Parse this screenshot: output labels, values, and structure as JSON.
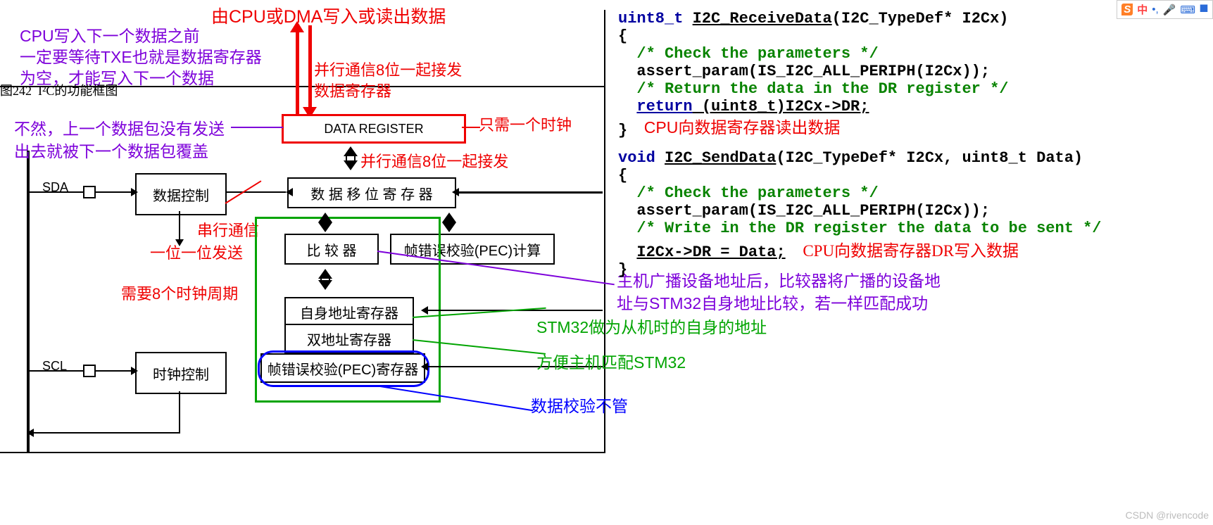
{
  "figureCaption": "图242  I²C的功能框图",
  "topRed": "由CPU或DMA写入或读出数据",
  "purple1a": "CPU写入下一个数据之前",
  "purple1b": "一定要等待TXE也就是数据寄存器",
  "purple1c": "为空，才能写入下一个数据",
  "purple2a": "不然，上一个数据包没有发送",
  "purple2b": "出去就被下一个数据包覆盖",
  "redPar1": "并行通信8位一起接发",
  "redPar2": "数据寄存器",
  "redPar3": "并行通信8位一起接发",
  "redOnlyClk": "只需一个时钟",
  "redSerial": "串行通信",
  "redOneBit": "一位一位发送",
  "red8clk": "需要8个时钟周期",
  "box_dataReg": "DATA REGISTER",
  "box_dc": "数据控制",
  "box_shift": "数 据 移 位 寄 存 器",
  "box_cmp": "比  较  器",
  "box_pecCalc": "帧错误校验(PEC)计算",
  "box_ownAddr": "自身地址寄存器",
  "box_dualAddr": "双地址寄存器",
  "box_pecReg": "帧错误校验(PEC)寄存器",
  "box_clkCtrl": "时钟控制",
  "sdaLabel": "SDA",
  "sclLabel": "SCL",
  "greenSlave": "STM32做为从机时的自身的地址",
  "greenMatch": "方便主机匹配STM32",
  "blueIgnore": "数据校验不管",
  "purpleCmpA": "主机广播设备地址后，比较器将广播的设备地",
  "purpleCmpB": "址与STM32自身地址比较，若一样匹配成功",
  "code": {
    "t_uint8": "uint8_t ",
    "recvFn": "I2C_ReceiveData",
    "recvSig": "(I2C_TypeDef* I2Cx)",
    "brO": "{",
    "brC": "}",
    "chk": "/* Check the parameters */",
    "assert": "assert_param(IS_I2C_ALL_PERIPH(I2Cx));",
    "retC": "/* Return the data in the DR register */",
    "retK": "return",
    "retE": " (uint8_t)I2Cx->DR;",
    "readLabel": "CPU向数据寄存器读出数据",
    "t_void": "void ",
    "sendFn": "I2C_SendData",
    "sendSig": "(I2C_TypeDef* I2Cx, uint8_t Data)",
    "wrC": "/* Write in the DR register the data to be sent */",
    "wrE": "I2Cx->DR = Data;",
    "writeLabel": "CPU向数据寄存器DR写入数据"
  },
  "watermark": "CSDN @rivencode",
  "ime": {
    "s": "S",
    "c": "中",
    "p": "•,",
    "mic": "🎤",
    "kbd": "⌨",
    "more": "⯀"
  }
}
